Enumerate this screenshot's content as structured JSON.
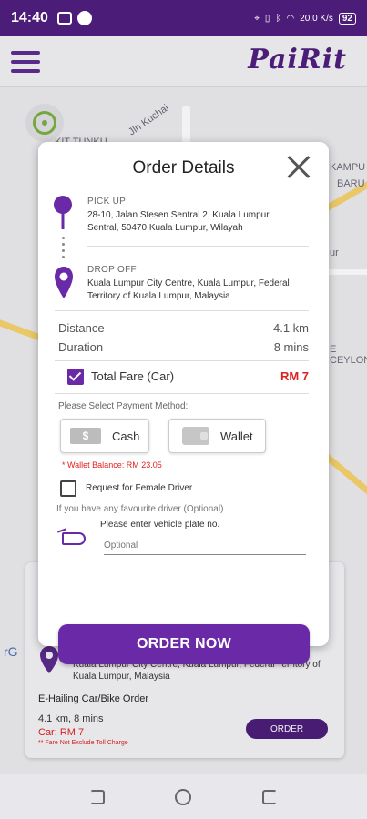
{
  "status": {
    "time": "14:40",
    "net": "20.0\nK/s",
    "battery": "92"
  },
  "app": {
    "logo": "PaiRit"
  },
  "map_labels": [
    "KIT TUNKU",
    "Jln Kuchai",
    "KAMPU",
    "BARU",
    "ur",
    "E CEYLON",
    "rG"
  ],
  "modal": {
    "title": "Order Details",
    "pickup_label": "PICK UP",
    "pickup_address": "28-10, Jalan Stesen Sentral 2, Kuala Lumpur Sentral, 50470 Kuala Lumpur, Wilayah",
    "dropoff_label": "DROP OFF",
    "dropoff_address": "Kuala Lumpur City Centre, Kuala Lumpur, Federal Territory of Kuala Lumpur, Malaysia",
    "distance_label": "Distance",
    "distance_value": "4.1 km",
    "duration_label": "Duration",
    "duration_value": "8 mins",
    "fare_label": "Total Fare (Car)",
    "fare_value": "RM 7",
    "payment_title": "Please Select Payment Method:",
    "cash_label": "Cash",
    "wallet_label": "Wallet",
    "wallet_balance": "* Wallet Balance: RM 23.05",
    "female_driver": "Request for Female Driver",
    "favourite_question": "If you have any favourite driver (Optional)",
    "plate_hint": "Please enter vehicle plate no.",
    "plate_placeholder": "Optional",
    "order_button": "ORDER NOW"
  },
  "background_card": {
    "address": "Kuala Lumpur City Centre, Kuala Lumpur, Federal Territory of Kuala Lumpur, Malaysia",
    "title": "E-Hailing Car/Bike Order",
    "meta": "4.1 km, 8 mins",
    "fare": "Car: RM 7",
    "note": "** Fare Not Exclude Toll Charge",
    "button": "ORDER"
  }
}
